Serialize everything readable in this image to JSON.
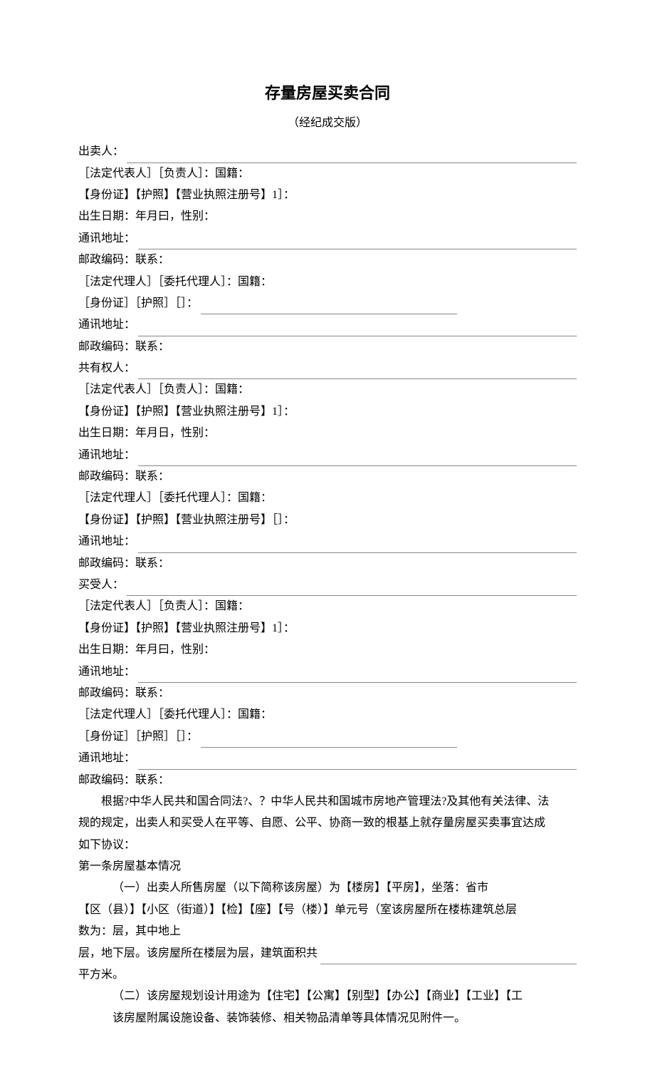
{
  "title": "存量房屋买卖合同",
  "subtitle": "（经纪成交版）",
  "seller": {
    "label": "出卖人：",
    "rep": "［法定代表人］［负责人］：国籍：",
    "id": "【身份证】【护照】【营业执照注册号】1］：",
    "birth": "出生日期：年月曰，性别：",
    "addr_label": "通讯地址：",
    "post": "邮政编码：联系：",
    "agent": "［法定代理人］［委托代理人］：国籍：",
    "agent_id_label": "［身份证］［护照］［］：",
    "addr_label2": "通讯地址：",
    "post2": "邮政编码：联系："
  },
  "coowner": {
    "label": "共有权人：",
    "rep": "［法定代表人］［负责人］：国籍：",
    "id": "【身份证】【护照】【营业执照注册号】1］：",
    "birth": "出生日期：年月日，性别：",
    "addr_label": "通讯地址：",
    "post": "邮政编码：联系：",
    "agent": "［法定代理人］［委托代理人］：国籍：",
    "agent_id": "【身份证】【护照】【营业执照注册号】［］：",
    "addr_label2": "通讯地址：",
    "post2": "邮政编码：联系："
  },
  "buyer": {
    "label": "买受人：",
    "rep": "［法定代表人］［负责人］：国籍：",
    "id": "【身份证】【护照】【营业执照注册号】1］：",
    "birth": "出生日期：年月曰，性别：",
    "addr_label": "通讯地址：",
    "post": "邮政编码：联系：",
    "agent": "［法定代理人］［委托代理人］：国籍：",
    "agent_id_label": "［身份证］［护照］［］：",
    "addr_label2": "通讯地址：",
    "post2": "邮政编码：联系："
  },
  "preamble1": "根据?中华人民共和国合同法?、？中华人民共和国城市房地产管理法?及其他有关法律、法",
  "preamble2": "规的规定，出卖人和买受人在平等、自愿、公平、协商一致的根基上就存量房屋买卖事宜达成",
  "preamble3": "如下协议：",
  "art1_head": "第一条房屋基本情况",
  "art1_1a": "（一）出卖人所售房屋（以下简称该房屋）为【楼房】【平房】，坐落：省市",
  "art1_1b": "【区（县）】【小区（街道）】【检】【座】【号（楼）】单元号（室该房屋所在楼栋建筑总层",
  "art1_1c": "数为：层，其中地上",
  "art1_1d_label": "层，地下层。该房屋所在楼层为层，建筑面积共",
  "art1_1e": "平方米。",
  "art1_2": "（二）该房屋规划设计用途为【住宅】【公寓】【别型】【办公】【商业】【工业】【工",
  "art1_3": "该房屋附属设施设备、装饰装修、相关物品清单等具体情况见附件一。"
}
